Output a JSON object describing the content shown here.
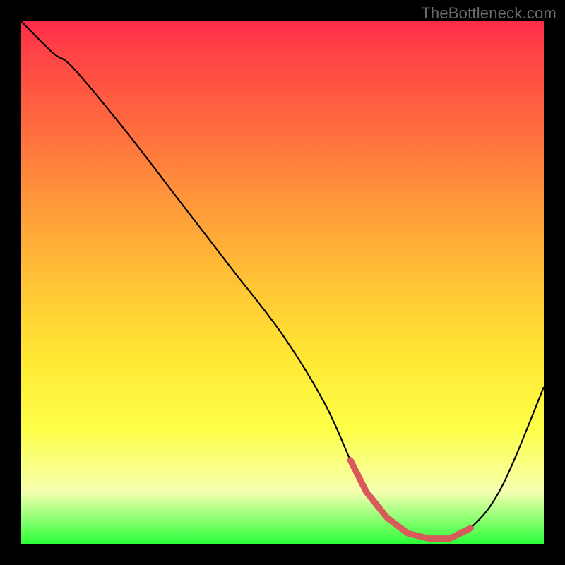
{
  "watermark": "TheBottleneck.com",
  "chart_data": {
    "type": "line",
    "title": "",
    "xlabel": "",
    "ylabel": "",
    "xlim": [
      0,
      100
    ],
    "ylim": [
      0,
      100
    ],
    "series": [
      {
        "name": "bottleneck-curve",
        "x": [
          0,
          6,
          10,
          20,
          30,
          40,
          50,
          58,
          63,
          66,
          70,
          74,
          78,
          82,
          86,
          92,
          100
        ],
        "values": [
          100,
          94,
          91,
          79,
          66,
          53,
          40,
          27,
          16,
          10,
          5,
          2,
          1,
          1,
          3,
          11,
          30
        ]
      }
    ],
    "flat_region": {
      "x_start": 63,
      "x_end": 86,
      "color": "#d85a5a",
      "thickness": 9
    }
  }
}
